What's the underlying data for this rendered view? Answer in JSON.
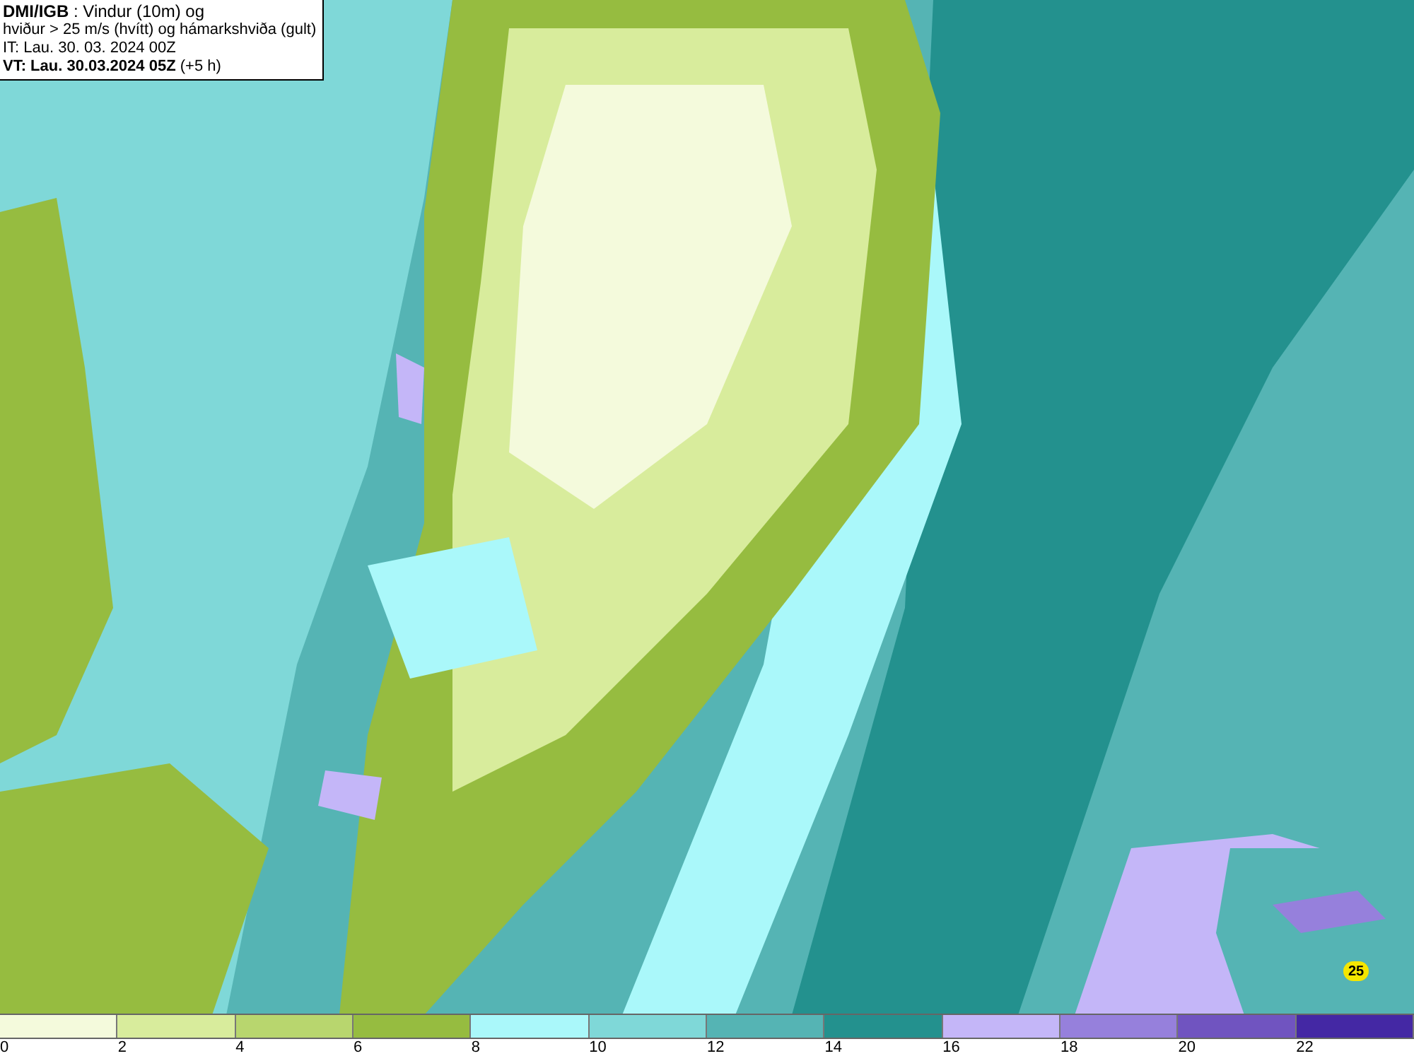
{
  "header": {
    "lines": [
      "**DMI/IGB** : Vindur (10m) og",
      "hviður > 25 m/s (hvítt) og hámarkshviða (gult)",
      "IT: Lau. 30. 03. 2024 00Z",
      "**VT: Lau. 30.03.2024 05Z** (+5 h)"
    ]
  },
  "map": {
    "gust_marker": "25"
  },
  "legend": {
    "segments": [
      {
        "color": "#f4fadc"
      },
      {
        "color": "#d8ec9c"
      },
      {
        "color": "#b8d66e"
      },
      {
        "color": "#96bc40"
      },
      {
        "color": "#aaf8fa"
      },
      {
        "color": "#7fd8d8"
      },
      {
        "color": "#55b4b4"
      },
      {
        "color": "#23918e"
      },
      {
        "color": "#c4b6f8"
      },
      {
        "color": "#9680dc"
      },
      {
        "color": "#7054c0"
      },
      {
        "color": "#4428a4"
      }
    ],
    "labels": [
      "0",
      "2",
      "4",
      "6",
      "8",
      "10",
      "12",
      "14",
      "16",
      "18",
      "20",
      "22"
    ]
  }
}
